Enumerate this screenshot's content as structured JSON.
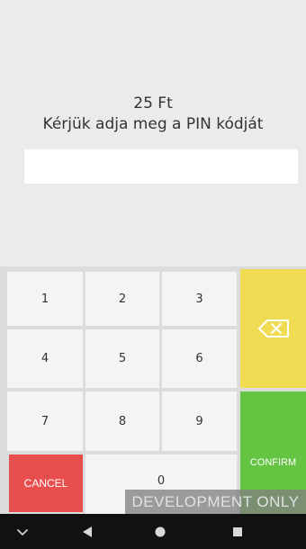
{
  "payment": {
    "amount": "25 Ft",
    "prompt": "Kérjük adja meg a PIN kódját",
    "pin_value": ""
  },
  "keypad": {
    "key_1": "1",
    "key_2": "2",
    "key_3": "3",
    "key_4": "4",
    "key_5": "5",
    "key_6": "6",
    "key_7": "7",
    "key_8": "8",
    "key_9": "9",
    "key_0": "0",
    "backspace_icon": "backspace-icon",
    "confirm_label": "CONFIRM",
    "cancel_label": "CANCEL"
  },
  "banner": {
    "text": "DEVELOPMENT ONLY"
  },
  "navbar": {
    "icons": [
      "chevron-down-icon",
      "back-triangle-icon",
      "home-circle-icon",
      "recents-square-icon"
    ]
  },
  "colors": {
    "background": "#ebebeb",
    "backspace": "#f0dc52",
    "confirm": "#66c443",
    "cancel": "#e94e4e",
    "navbar": "#111111"
  }
}
